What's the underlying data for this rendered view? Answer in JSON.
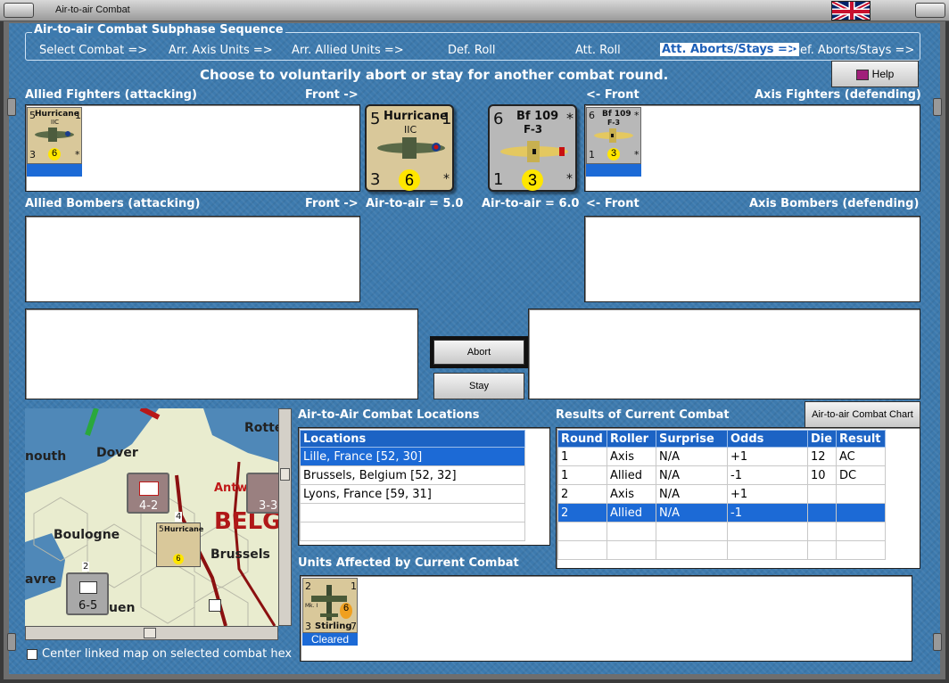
{
  "window": {
    "title": "Air-to-air Combat"
  },
  "sequence": {
    "title": "Air-to-air Combat Subphase Sequence",
    "steps": [
      "Select Combat =>",
      "Arr. Axis Units =>",
      "Arr. Allied Units =>",
      "Def. Roll",
      "Att. Roll",
      "Att. Aborts/Stays =>",
      "Def. Aborts/Stays =>"
    ],
    "active_index": 5
  },
  "instruction": "Choose to voluntarily abort or stay for another combat round.",
  "help_label": "Help",
  "labels": {
    "allied_fighters": "Allied Fighters (attacking)",
    "front_right": "Front ->",
    "front_left": "<- Front",
    "axis_fighters": "Axis Fighters (defending)",
    "allied_bombers": "Allied Bombers (attacking)",
    "axis_bombers": "Axis Bombers (defending)",
    "allied_a2a": "Air-to-air = 5.0",
    "axis_a2a": "Air-to-air = 6.0"
  },
  "allied_unit": {
    "name": "Hurricane",
    "sub": "IIC",
    "top_left": "5",
    "top_right": "1",
    "bottom_left": "3",
    "center": "6",
    "bottom_right": "*"
  },
  "axis_unit": {
    "name": "Bf 109",
    "sub": "F-3",
    "top_left": "6",
    "top_right": "*",
    "bottom_left": "1",
    "center": "3",
    "bottom_right": "*"
  },
  "buttons": {
    "abort": "Abort",
    "stay": "Stay",
    "chart": "Air-to-air Combat Chart"
  },
  "locations": {
    "title": "Air-to-Air Combat Locations",
    "header": "Locations",
    "rows": [
      "Lille, France [52, 30]",
      "Brussels, Belgium [52, 32]",
      "Lyons, France [59, 31]"
    ],
    "selected": 0
  },
  "results": {
    "title": "Results of Current Combat",
    "headers": [
      "Round",
      "Roller",
      "Surprise",
      "Odds",
      "Die",
      "Result"
    ],
    "rows": [
      [
        "1",
        "Axis",
        "N/A",
        "+1",
        "12",
        "AC"
      ],
      [
        "1",
        "Allied",
        "N/A",
        "-1",
        "10",
        "DC"
      ],
      [
        "2",
        "Axis",
        "N/A",
        "+1",
        "",
        ""
      ],
      [
        "2",
        "Allied",
        "N/A",
        "-1",
        "",
        ""
      ]
    ],
    "selected": 3
  },
  "affected": {
    "title": "Units Affected by Current Combat",
    "unit": {
      "top_left": "2",
      "top_right": "1",
      "mid_left": "Mk. I",
      "bottom_left": "3",
      "center": "6",
      "bottom_right": "7",
      "name": "Stirling",
      "status": "Cleared"
    }
  },
  "map": {
    "places": [
      "Dover",
      "Rotterd",
      "nouth",
      "Boulogne",
      "Brussels",
      "Antw",
      "BELG",
      "avre",
      "uen"
    ],
    "unit_labels": [
      "4-2",
      "3-3",
      "6-5",
      "4",
      "2"
    ]
  },
  "center_checkbox": {
    "label": "Center linked map on selected combat hex",
    "checked": false
  }
}
